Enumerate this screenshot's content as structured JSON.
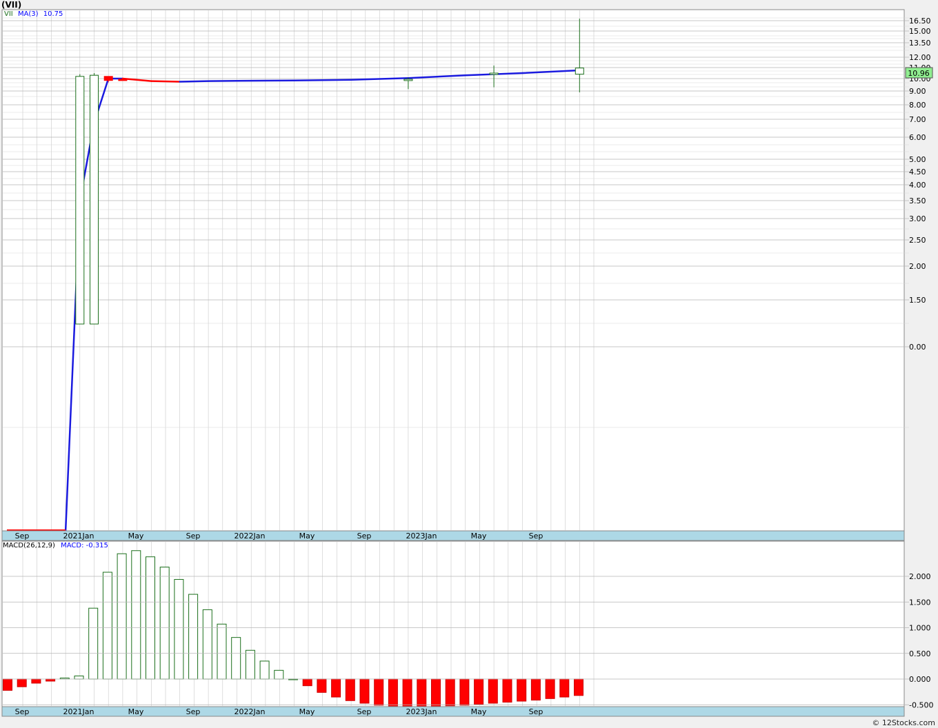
{
  "title": "(VII)",
  "legend": {
    "symbol": "VII",
    "ma_label": "MA(3)",
    "ma_value": "10.75",
    "ma_color": "#0000ff",
    "symbol_color": "#1a6e1a"
  },
  "last_price_badge": "10.96",
  "macd_legend": {
    "label": "MACD(26,12,9)",
    "value_label": "MACD: -0.315"
  },
  "footer": "© 12Stocks.com",
  "colors": {
    "up": "#1a6e1a",
    "down": "#ff0000",
    "ma": "#1a1adf",
    "grid": "#c8c8c8",
    "axis_bar": "#add8e6",
    "badge": "#90ee90"
  },
  "chart_data": [
    {
      "type": "candlestick",
      "scale": "log",
      "title": "(VII)",
      "x_tick_labels": [
        "Sep",
        "2021Jan",
        "May",
        "Sep",
        "2022Jan",
        "May",
        "Sep",
        "2023Jan",
        "May",
        "Sep"
      ],
      "y_tick_labels": [
        "16.50",
        "15.00",
        "13.50",
        "12.00",
        "11.00",
        "10.00",
        "9.00",
        "8.00",
        "7.00",
        "6.00",
        "5.00",
        "4.50",
        "4.00",
        "3.50",
        "3.00",
        "2.50",
        "2.00",
        "1.50",
        "0.00"
      ],
      "candles": [
        {
          "month": "2020-12",
          "open": 0.0,
          "high": 0.0,
          "low": 0.0,
          "close": 0.0
        },
        {
          "month": "2021-01",
          "open": 0.3,
          "high": 10.4,
          "low": 0.3,
          "close": 10.2
        },
        {
          "month": "2021-02",
          "open": 0.3,
          "high": 10.5,
          "low": 0.3,
          "close": 10.3
        },
        {
          "month": "2021-03",
          "open": 10.2,
          "high": 10.2,
          "low": 9.7,
          "close": 9.85
        },
        {
          "month": "2021-04",
          "open": 9.95,
          "high": 10.0,
          "low": 9.85,
          "close": 9.9
        },
        {
          "month": "2022-12",
          "open": 9.9,
          "high": 10.1,
          "low": 9.15,
          "close": 9.95
        },
        {
          "month": "2023-06",
          "open": 10.4,
          "high": 11.2,
          "low": 9.3,
          "close": 10.5
        },
        {
          "month": "2023-12",
          "open": 10.4,
          "high": 16.8,
          "low": 8.9,
          "close": 10.96
        }
      ],
      "ma_series": {
        "name": "MA(3)",
        "points": [
          {
            "month": "2020-08",
            "value": 0.0
          },
          {
            "month": "2020-12",
            "value": 0.0
          },
          {
            "month": "2021-01",
            "value": 3.5
          },
          {
            "month": "2021-02",
            "value": 6.8
          },
          {
            "month": "2021-03",
            "value": 10.0
          },
          {
            "month": "2021-04",
            "value": 10.0
          },
          {
            "month": "2021-06",
            "value": 9.8
          },
          {
            "month": "2021-08",
            "value": 9.75
          },
          {
            "month": "2021-10",
            "value": 9.8
          },
          {
            "month": "2021-12",
            "value": 9.82
          },
          {
            "month": "2022-04",
            "value": 9.85
          },
          {
            "month": "2022-08",
            "value": 9.9
          },
          {
            "month": "2022-12",
            "value": 10.05
          },
          {
            "month": "2023-04",
            "value": 10.3
          },
          {
            "month": "2023-08",
            "value": 10.5
          },
          {
            "month": "2023-12",
            "value": 10.75
          }
        ]
      }
    },
    {
      "type": "bar",
      "title": "MACD(26,12,9)",
      "x_tick_labels": [
        "Sep",
        "2021Jan",
        "May",
        "Sep",
        "2022Jan",
        "May",
        "Sep",
        "2023Jan",
        "May",
        "Sep"
      ],
      "y_tick_labels": [
        "2.000",
        "1.500",
        "1.000",
        "0.500",
        "0.000",
        "-0.500"
      ],
      "ylim": [
        -0.55,
        2.5
      ],
      "values": [
        -0.22,
        -0.15,
        -0.08,
        -0.04,
        0.02,
        0.06,
        1.38,
        2.08,
        2.44,
        2.5,
        2.38,
        2.18,
        1.94,
        1.65,
        1.35,
        1.07,
        0.81,
        0.56,
        0.35,
        0.17,
        0.0,
        -0.13,
        -0.26,
        -0.35,
        -0.42,
        -0.47,
        -0.51,
        -0.53,
        -0.53,
        -0.53,
        -0.53,
        -0.52,
        -0.51,
        -0.49,
        -0.47,
        -0.45,
        -0.43,
        -0.41,
        -0.38,
        -0.35,
        -0.32
      ]
    }
  ]
}
